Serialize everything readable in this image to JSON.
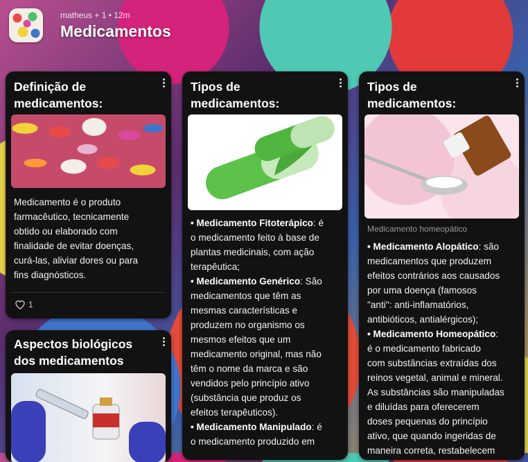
{
  "board": {
    "meta": "matheus + 1 •  12m",
    "title": "Medicamentos",
    "icon": "pills-board-icon"
  },
  "cards": {
    "definicao": {
      "title_line1": "Definição de",
      "title_line2": "medicamentos:",
      "body_lines": [
        "Medicamento é o produto",
        "farmacêutico, tecnicamente",
        "obtido ou elaborado com",
        "finalidade de evitar doenças,",
        "curá-las, aliviar dores ou para",
        "fins diagnósticos."
      ],
      "likes": "1"
    },
    "aspectos": {
      "title_line1": "Aspectos biológicos",
      "title_line2": "dos medicamentos"
    },
    "tipos1": {
      "title_line1": "Tipos de",
      "title_line2": "medicamentos:",
      "bullet": "• ",
      "lines": [
        {
          "bold": "Medicamento Fitoterápico",
          "rest": ": é",
          "bullet": true
        },
        {
          "rest": "o medicamento feito  à base de"
        },
        {
          "rest": "plantas medicinais, com ação"
        },
        {
          "rest": "terapêutica;"
        },
        {
          "bold": "Medicamento Genérico",
          "rest": ": São",
          "bullet": true
        },
        {
          "rest": "medicamentos que têm as"
        },
        {
          "rest": "mesmas características e"
        },
        {
          "rest": "produzem no organismo os"
        },
        {
          "rest": "mesmos efeitos que um"
        },
        {
          "rest": "medicamento original, mas não"
        },
        {
          "rest": "têm o nome da marca e são"
        },
        {
          "rest": "vendidos pelo princípio ativo"
        },
        {
          "rest": "(substância que produz os"
        },
        {
          "rest": "efeitos terapêuticos)."
        },
        {
          "bold": "Medicamento Manipulado",
          "rest": ": é",
          "bullet": true
        },
        {
          "rest": "o medicamento produzido em"
        }
      ]
    },
    "tipos2": {
      "title_line1": "Tipos de",
      "title_line2": "medicamentos:",
      "caption": "Medicamento homeopático",
      "bullet": "• ",
      "lines": [
        {
          "bold": "Medicamento Alopático",
          "rest": ": são",
          "bullet": true
        },
        {
          "rest": "medicamentos que produzem"
        },
        {
          "rest": "efeitos contrários aos causados"
        },
        {
          "rest": "por uma doença (famosos"
        },
        {
          "rest": "\"anti\": anti-inflamatórios,"
        },
        {
          "rest": "antibióticos, antialérgicos);"
        },
        {
          "bold": "Medicamento Homeopático",
          "rest": ":",
          "bullet": true
        },
        {
          "rest": "é o medicamento fabricado"
        },
        {
          "rest": "com substâncias extraídas dos"
        },
        {
          "rest": "reinos vegetal, animal e mineral."
        },
        {
          "rest": "As substâncias são manipuladas"
        },
        {
          "rest": "e diluídas para oferecerem"
        },
        {
          "rest": "doses pequenas do princípio"
        },
        {
          "rest": "ativo, que quando ingeridas de"
        },
        {
          "rest": "maneira correta, restabelecem"
        }
      ]
    }
  }
}
